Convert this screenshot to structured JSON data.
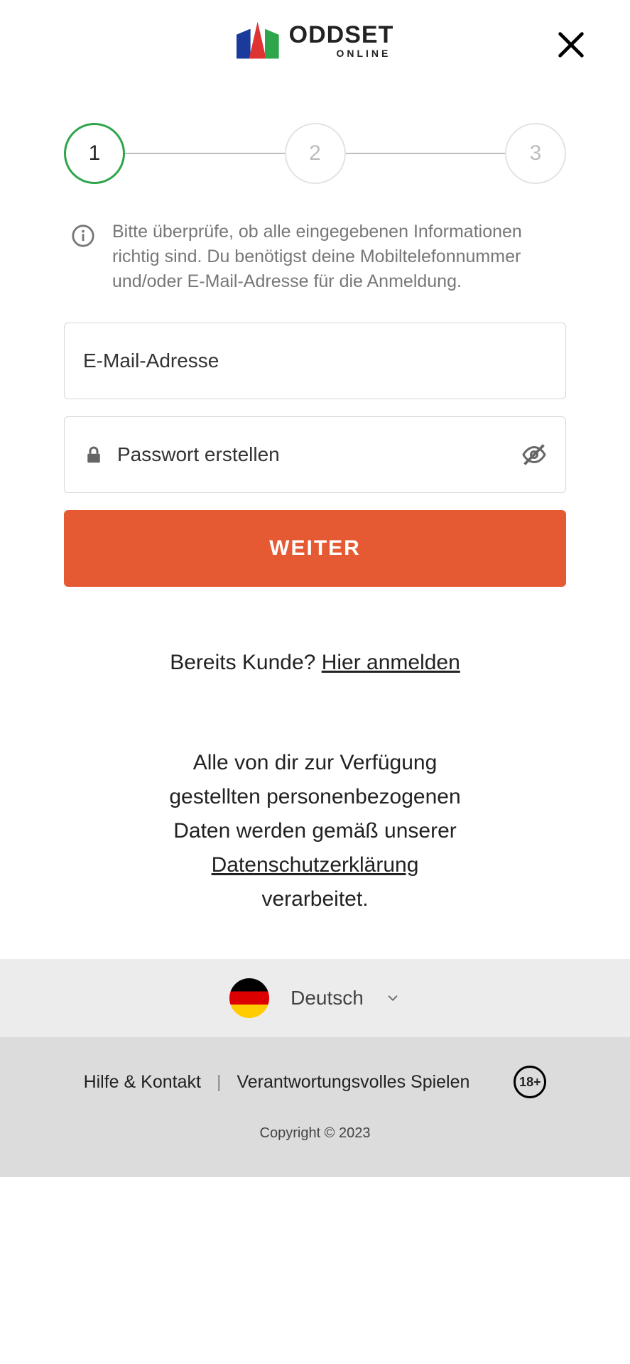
{
  "brand": {
    "name": "ODDSET",
    "sub": "ONLINE"
  },
  "stepper": {
    "steps": [
      "1",
      "2",
      "3"
    ],
    "active_index": 0
  },
  "info_text": "Bitte überprüfe, ob alle eingegebenen Informationen richtig sind. Du benötigst deine Mobiltelefonnummer und/oder E-Mail-Adresse für die Anmeldung.",
  "form": {
    "email_placeholder": "E-Mail-Adresse",
    "password_placeholder": "Passwort erstellen",
    "submit_label": "WEITER"
  },
  "login": {
    "prefix": "Bereits Kunde? ",
    "link": "Hier anmelden"
  },
  "privacy": {
    "line1": "Alle von dir zur Verfügung gestellten personenbezogenen Daten werden gemäß unserer ",
    "link": "Datenschutzerklärung",
    "line2": " verarbeitet."
  },
  "language": {
    "label": "Deutsch"
  },
  "footer": {
    "help": "Hilfe & Kontakt",
    "responsible": "Verantwortungsvolles Spielen",
    "age_badge": "18+",
    "copyright": "Copyright © 2023"
  }
}
